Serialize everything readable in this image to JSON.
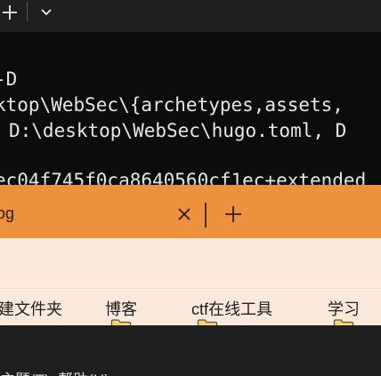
{
  "terminal": {
    "lines": [
      "-D",
      "ktop\\WebSec\\{archetypes,assets,",
      "D:\\desktop\\WebSec\\hugo.toml, D",
      "",
      "ec04f745f0ca8640560cf1ec+extended"
    ]
  },
  "browser": {
    "tab_title": "og",
    "bookmarks": [
      {
        "label": "建文件夹",
        "icon": "none"
      },
      {
        "label": "博客",
        "icon": "folder-icon"
      },
      {
        "label": "ctf在线工具",
        "icon": "folder-icon"
      },
      {
        "label": "学习",
        "icon": "folder-icon"
      }
    ],
    "menu_text": "主题(T)  帮助(H)"
  },
  "colors": {
    "terminal_bg": "#0c0c0c",
    "terminal_tabbar": "#1f1f1f",
    "browser_tabbar": "#ec923c",
    "browser_toolbar": "#fbe9dc",
    "folder_fill": "#f6d673"
  }
}
